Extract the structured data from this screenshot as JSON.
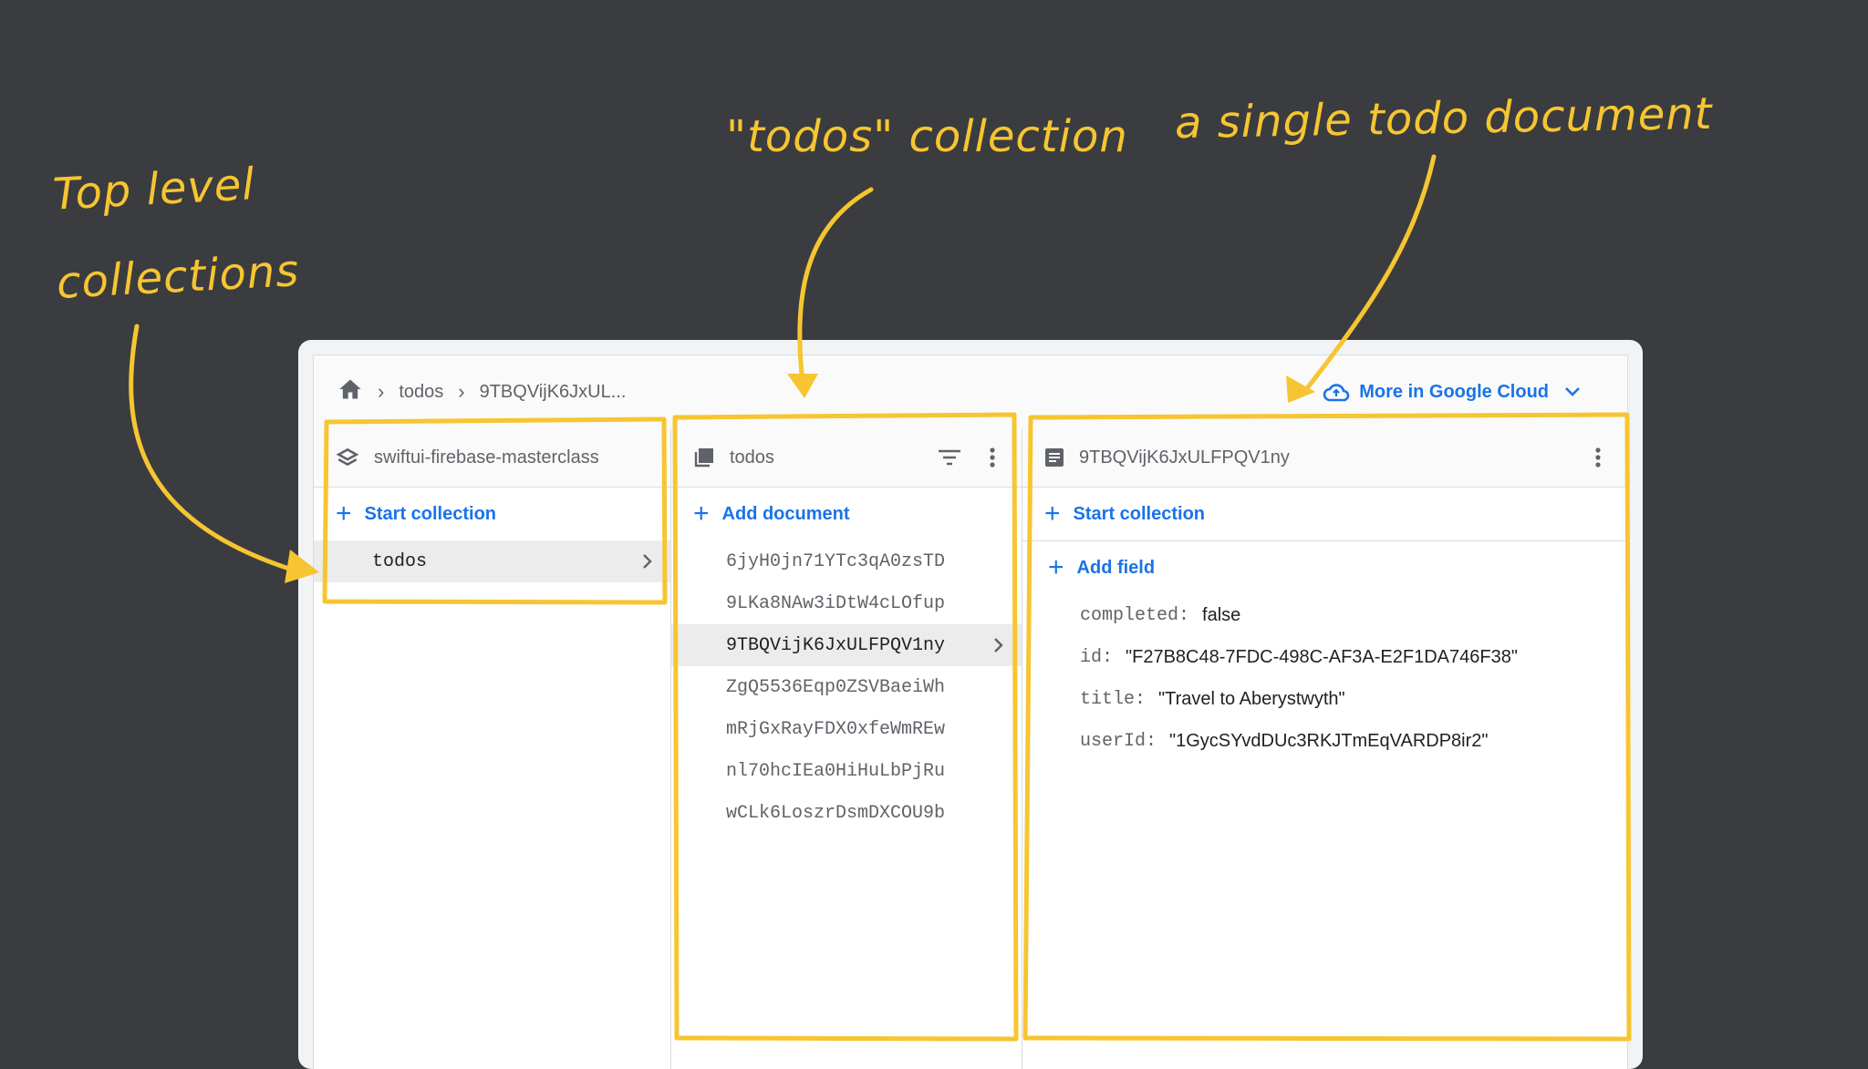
{
  "annotations": {
    "top_level_line1": "Top level",
    "top_level_line2": "collections",
    "todos_collection": "\"todos\" collection",
    "single_doc": "a single todo document"
  },
  "breadcrumb": {
    "item1": "todos",
    "item2": "9TBQVijK6JxUL..."
  },
  "google_cloud": {
    "label": "More in Google Cloud"
  },
  "panel_root": {
    "title": "swiftui-firebase-masterclass",
    "action": "Start collection",
    "items": [
      "todos"
    ]
  },
  "panel_collection": {
    "title": "todos",
    "action": "Add document",
    "documents": [
      "6jyH0jn71YTc3qA0zsTD",
      "9LKa8NAw3iDtW4cLOfup",
      "9TBQVijK6JxULFPQV1ny",
      "ZgQ5536Eqp0ZSVBaeiWh",
      "mRjGxRayFDX0xfeWmREw",
      "nl70hcIEa0HiHuLbPjRu",
      "wCLk6LoszrDsmDXCOU9b"
    ]
  },
  "panel_document": {
    "title": "9TBQVijK6JxULFPQV1ny",
    "action_collection": "Start collection",
    "action_field": "Add field",
    "fields": [
      {
        "key": "completed:",
        "value": "false"
      },
      {
        "key": "id:",
        "value": "\"F27B8C48-7FDC-498C-AF3A-E2F1DA746F38\""
      },
      {
        "key": "title:",
        "value": "\"Travel to Aberystwyth\""
      },
      {
        "key": "userId:",
        "value": "\"1GycSYvdDUc3RKJTmEqVARDP8ir2\""
      }
    ]
  },
  "colors": {
    "annotation": "#f6c531",
    "accent": "#1a73e8",
    "background": "#3b3c3f"
  }
}
